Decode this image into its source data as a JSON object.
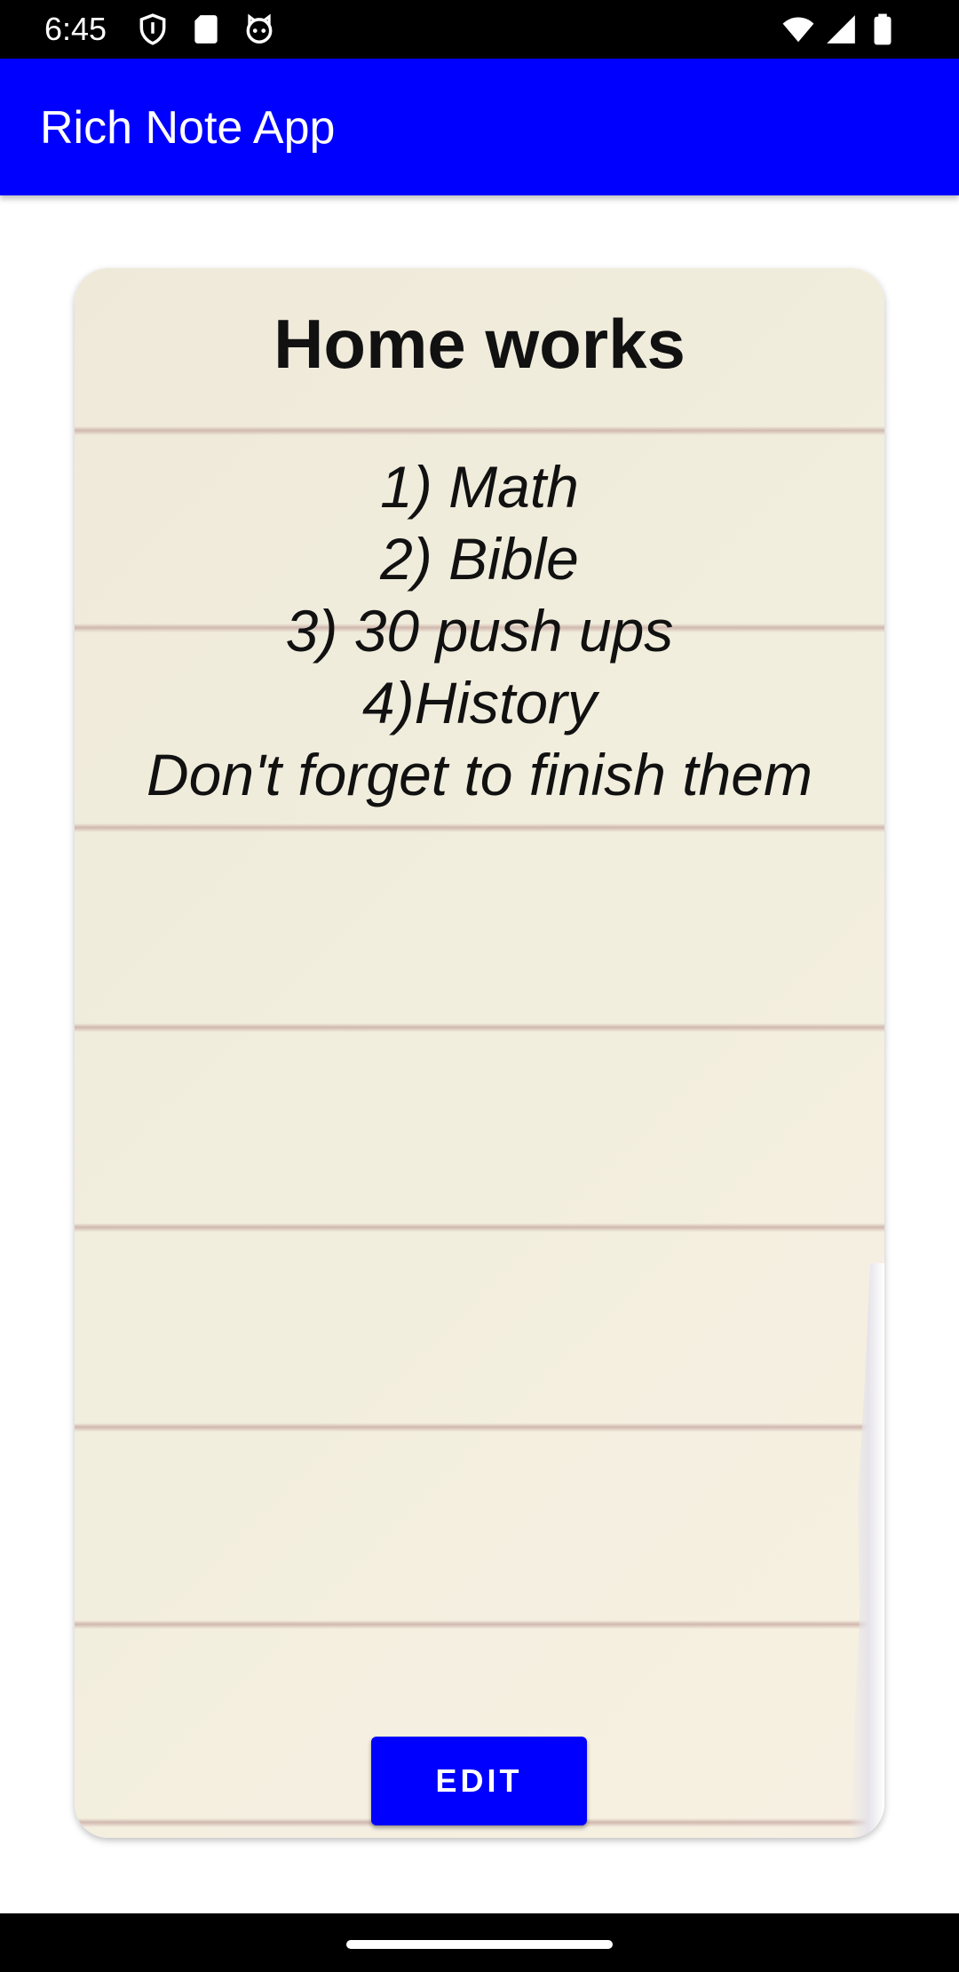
{
  "status_bar": {
    "time": "6:45",
    "left_icons": [
      "shield-icon",
      "sd-card-icon",
      "cat-face-icon"
    ],
    "right_icons": [
      "wifi-icon",
      "cellular-signal-icon",
      "battery-icon"
    ]
  },
  "app_bar": {
    "title": "Rich Note App",
    "color": "#0000ff"
  },
  "note": {
    "title": "Home works",
    "lines": [
      "1) Math",
      "2) Bible",
      "3) 30 push ups",
      "4)History",
      "Don't forget to finish them"
    ],
    "edit_label": "EDIT"
  },
  "colors": {
    "accent": "#0000ff",
    "paper": "#f1eedd"
  }
}
